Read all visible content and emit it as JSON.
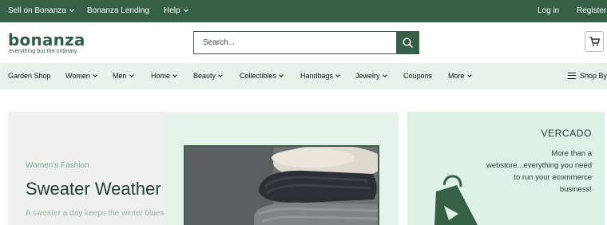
{
  "topbar": {
    "sell_label": "Sell on Bonanza",
    "lending_label": "Bonanza Lending",
    "help_label": "Help",
    "login_label": "Log in",
    "register_label": "Register"
  },
  "header": {
    "logo_text": "bonanza",
    "logo_tagline": "everything but the ordinary",
    "search_placeholder": "Search..."
  },
  "nav": {
    "items": [
      {
        "label": "Garden Shop"
      },
      {
        "label": "Women"
      },
      {
        "label": "Men"
      },
      {
        "label": "Home"
      },
      {
        "label": "Beauty"
      },
      {
        "label": "Collectibles"
      },
      {
        "label": "Handbags"
      },
      {
        "label": "Jewelry"
      },
      {
        "label": "Coupons"
      },
      {
        "label": "More"
      }
    ],
    "shop_by_label": "Shop By"
  },
  "hero": {
    "eyebrow": "Women's Fashion",
    "title": "Sweater Weather",
    "subtitle": "A sweater a day keeps the winter blues"
  },
  "promo": {
    "title": "VERCADO",
    "text": "More than a webstore...everything you need to run your ecommerce business!"
  },
  "colors": {
    "brand_green": "#356047",
    "nav_bg": "#e9f1ec",
    "promo_bg": "#ddf1e6"
  }
}
